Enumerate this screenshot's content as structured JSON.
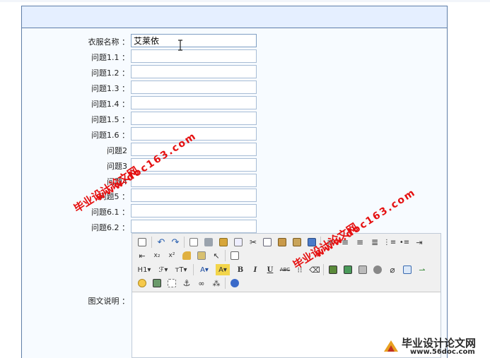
{
  "form": {
    "fields": [
      {
        "label": "衣服名称 ：",
        "value": "艾莱依"
      },
      {
        "label": "问题1.1 ：",
        "value": ""
      },
      {
        "label": "问题1.2 ：",
        "value": ""
      },
      {
        "label": "问题1.3 ：",
        "value": ""
      },
      {
        "label": "问题1.4 ：",
        "value": ""
      },
      {
        "label": "问题1.5 ：",
        "value": ""
      },
      {
        "label": "问题1.6 ：",
        "value": ""
      },
      {
        "label": "问题2",
        "value": ""
      },
      {
        "label": "问题3",
        "value": ""
      },
      {
        "label": "问题4",
        "value": ""
      },
      {
        "label": "问题5 ：",
        "value": ""
      },
      {
        "label": "问题6.1 ：",
        "value": ""
      },
      {
        "label": "问题6.2 ：",
        "value": ""
      }
    ],
    "editor_label": "图文说明 ："
  },
  "toolbar": {
    "row1": [
      "source-icon",
      "undo-icon",
      "redo-icon",
      "preview-icon",
      "print-icon",
      "template-icon",
      "select-all-icon",
      "cut-icon",
      "copy-icon",
      "paste-icon",
      "paste-text-icon",
      "align-left-icon",
      "align-center-icon",
      "align-right-icon",
      "align-justify-icon",
      "ordered-list-icon",
      "unordered-list-icon",
      "indent-icon"
    ],
    "row2": [
      "outdent-icon",
      "subscript-icon",
      "superscript-icon",
      "clear-format-icon",
      "quick-format-icon",
      "select-all-icon",
      "fullscreen-icon"
    ],
    "row3": [
      "H1▾",
      "ℱ▾",
      "тT▾",
      "A▾",
      "A▾",
      "B",
      "I",
      "U",
      "ABC",
      "line-height-icon",
      "eraser-icon",
      "image-icon",
      "multi-image-icon",
      "flash-icon",
      "media-icon",
      "attachment-icon",
      "table-icon",
      "horizontal-rule-icon"
    ],
    "row4": [
      "emoticon-icon",
      "code-icon",
      "page-break-icon",
      "anchor-icon",
      "link-icon",
      "unlink-icon",
      "about-icon"
    ]
  },
  "watermarks": {
    "line1": "毕业设计论文网",
    "line2": "www.doc163.com",
    "logo_text": "毕业设计论文网",
    "logo_url": "www.56doc.com"
  },
  "colors": {
    "watermark": "#e51010",
    "panel_border": "#5f7ea8",
    "panel_header": "#e5efff"
  }
}
